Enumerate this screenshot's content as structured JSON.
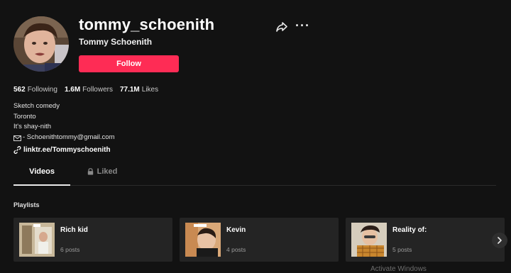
{
  "profile": {
    "username": "tommy_schoenith",
    "display_name": "Tommy Schoenith",
    "follow_label": "Follow",
    "share_icon": "share-icon",
    "more_label": "···"
  },
  "stats": [
    {
      "value": "562",
      "label": "Following"
    },
    {
      "value": "1.6M",
      "label": "Followers"
    },
    {
      "value": "77.1M",
      "label": "Likes"
    }
  ],
  "bio": {
    "lines": [
      "Sketch comedy",
      "Toronto",
      "It's shay-nith"
    ],
    "email": "- Schoenithtommy@gmail.com",
    "link": "linktr.ee/Tommyschoenith"
  },
  "tabs": {
    "videos": "Videos",
    "liked": "Liked"
  },
  "playlists": {
    "title": "Playlists",
    "items": [
      {
        "name": "Rich kid",
        "posts": "6 posts"
      },
      {
        "name": "Kevin",
        "posts": "4 posts"
      },
      {
        "name": "Reality of:",
        "posts": "5 posts"
      }
    ]
  },
  "colors": {
    "accent": "#fe2c55",
    "background": "#121212",
    "card": "#242424"
  },
  "watermark": "Activate Windows"
}
